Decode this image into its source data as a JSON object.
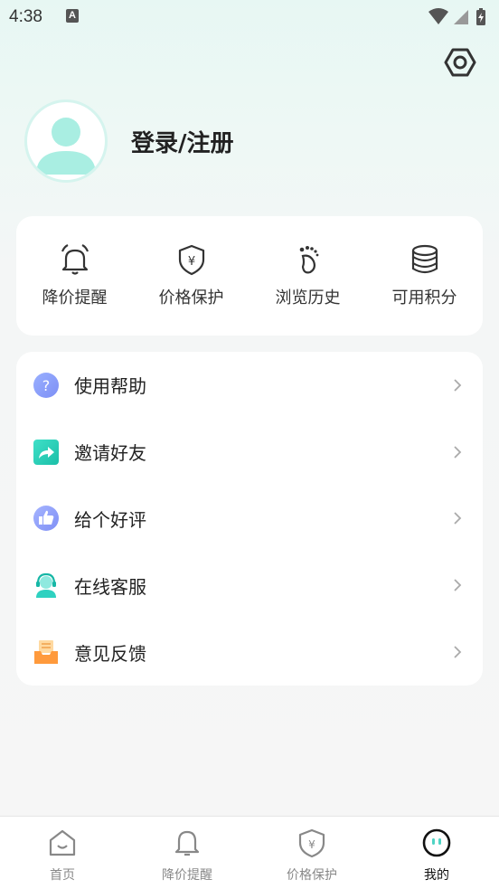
{
  "status_bar": {
    "time": "4:38",
    "notification_icon": "a-icon",
    "wifi_icon": "wifi-icon",
    "signal_icon": "signal-icon",
    "battery_icon": "battery-charging-icon"
  },
  "header": {
    "settings_icon": "settings-hexagon-icon",
    "avatar_icon": "default-avatar-icon",
    "login_label": "登录/注册"
  },
  "quick_actions": [
    {
      "label": "降价提醒",
      "icon": "bell-icon"
    },
    {
      "label": "价格保护",
      "icon": "shield-yen-icon"
    },
    {
      "label": "浏览历史",
      "icon": "footprint-icon"
    },
    {
      "label": "可用积分",
      "icon": "coins-stack-icon"
    }
  ],
  "menu": [
    {
      "label": "使用帮助",
      "icon": "help-icon"
    },
    {
      "label": "邀请好友",
      "icon": "share-icon"
    },
    {
      "label": "给个好评",
      "icon": "thumbs-up-icon"
    },
    {
      "label": "在线客服",
      "icon": "customer-service-icon"
    },
    {
      "label": "意见反馈",
      "icon": "feedback-icon"
    }
  ],
  "tab_bar": [
    {
      "label": "首页",
      "icon": "home-icon",
      "active": false
    },
    {
      "label": "降价提醒",
      "icon": "bell-icon",
      "active": false
    },
    {
      "label": "价格保护",
      "icon": "shield-yen-icon",
      "active": false
    },
    {
      "label": "我的",
      "icon": "profile-face-icon",
      "active": true
    }
  ],
  "colors": {
    "accent": "#4fd3c4",
    "background_top": "#e7f7f3",
    "card": "#ffffff",
    "tab_active": "#111111",
    "tab_inactive": "#888888"
  }
}
